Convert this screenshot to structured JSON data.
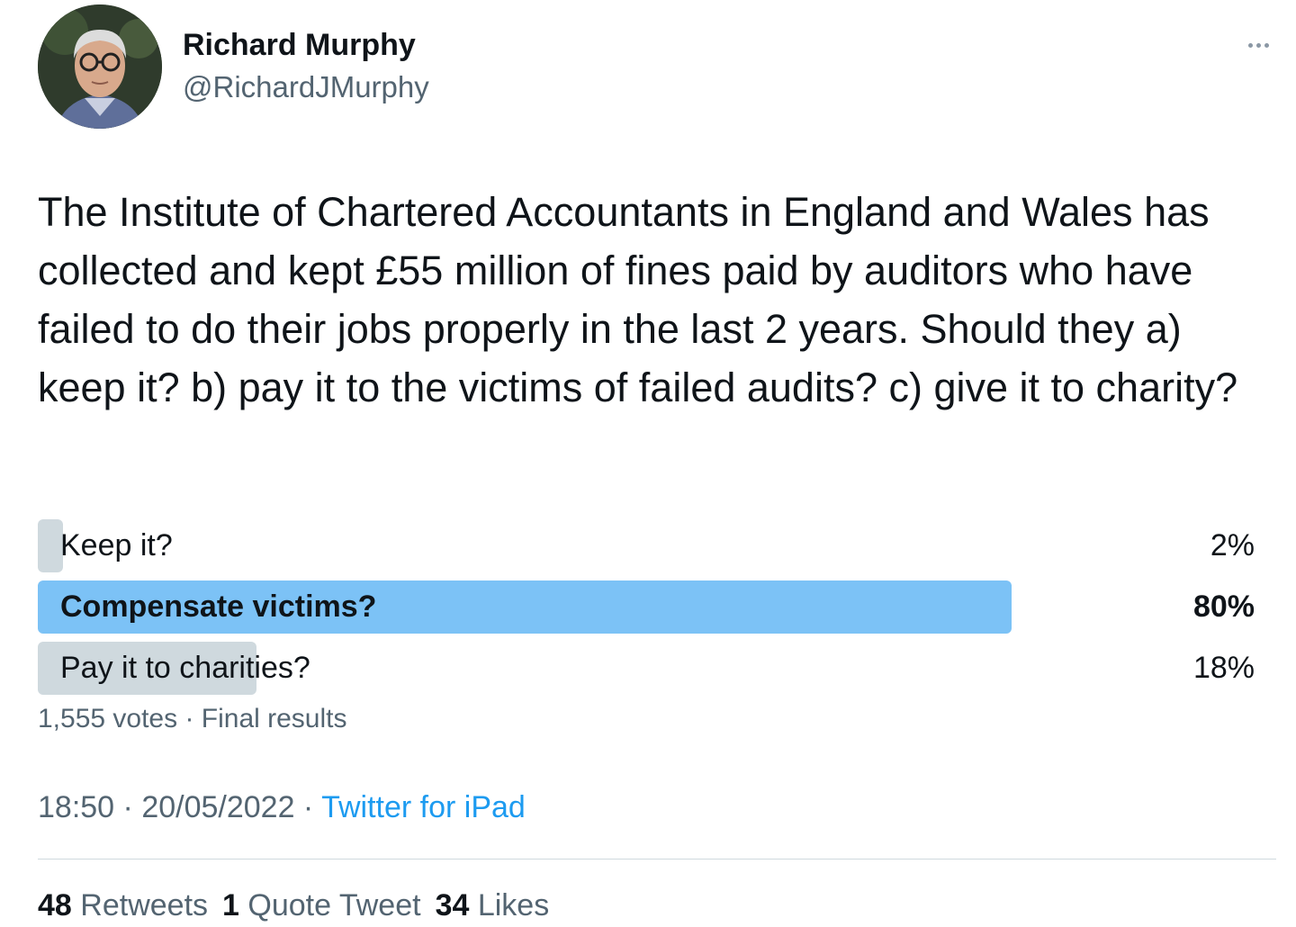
{
  "author": {
    "name": "Richard Murphy",
    "handle": "@RichardJMurphy"
  },
  "tweet": {
    "text": "The Institute of Chartered Accountants in England and Wales has collected and kept £55 million of fines paid by auditors who have failed to do their jobs properly in the last 2 years. Should they a) keep it? b) pay it to the victims of failed audits? c) give it to charity?"
  },
  "poll": {
    "options": [
      {
        "label": "Keep it?",
        "percent_text": "2%",
        "share": 0.02,
        "winner": false
      },
      {
        "label": "Compensate victims?",
        "percent_text": "80%",
        "share": 0.8,
        "winner": true
      },
      {
        "label": "Pay it to charities?",
        "percent_text": "18%",
        "share": 0.18,
        "winner": false
      }
    ],
    "meta": "1,555 votes · Final results"
  },
  "timestamp": {
    "time": "18:50",
    "separator": " · ",
    "date": "20/05/2022",
    "source": "Twitter for iPad"
  },
  "stats": {
    "retweets_count": "48",
    "retweets_label": "Retweets",
    "quotes_count": "1",
    "quotes_label": "Quote Tweet",
    "likes_count": "34",
    "likes_label": "Likes"
  },
  "colors": {
    "winner_bar": "#7cc2f6",
    "loser_bar": "#cfd9de",
    "link": "#1d9bf0",
    "secondary_text": "#536471"
  },
  "icons": {
    "more": "more-horizontal-icon"
  }
}
